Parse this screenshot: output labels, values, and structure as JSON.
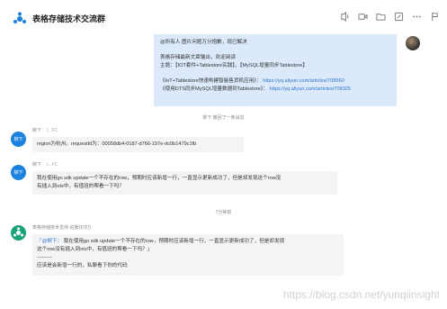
{
  "header": {
    "title": "表格存储技术交流群",
    "icons": [
      "phone-icon",
      "video-icon",
      "folder-icon",
      "note-icon",
      "more-icon",
      "flag-icon"
    ]
  },
  "msg_right": {
    "lines": [
      "@所有人  图片问题万分抱歉，现已解决",
      "表格存储最新文章输出，欢迎阅读",
      "主题：【IOT套件+Tablestore实践】、【MySQL增量同步Tablestore】",
      "《IoT+Tablestore快速构建智能售货机应用》：",
      "《使用DTS同步MySQL增量数据到Tablestore》："
    ],
    "links": [
      "https://yq.aliyun.com/articles/708960",
      "https://yq.aliyun.com/articles/708325"
    ]
  },
  "system_recall": "柳下 撤回了一条消息",
  "msg1": {
    "avatar": "柳下",
    "sender": "柳下",
    "tag": "(...FC",
    "text": "region为杭州。requestId为：00058db4-0187-d766-197e-dc0b1479c1fb"
  },
  "msg2": {
    "avatar": "柳下",
    "sender": "柳下",
    "tag": "(...FC",
    "lines": [
      "我在使用go sdk update一个不存在的row，预期时应该新增一行，一直显示更新成功了，但是却发现这个row没",
      "有插入到ots中，有值班的帮看一下吗？"
    ]
  },
  "time_sep": "7分钟前",
  "msg3": {
    "sender": "表格存储技术支持-伯衡",
    "tag": "(钉钉)",
    "quote_mention": "「@柳下：",
    "quote_lines": [
      "我在使用go sdk update一个不存在的row，预期时应该新增一行，一直显示更新成功了，但是却发现",
      "这个row没有插入到ots中，有值班的帮看一下吗？」"
    ],
    "divider": "---------",
    "reply": "应该是会新增一行的，私聊看下你的代码"
  },
  "watermark": "https://blog.csdn.net/yunqiinsight"
}
